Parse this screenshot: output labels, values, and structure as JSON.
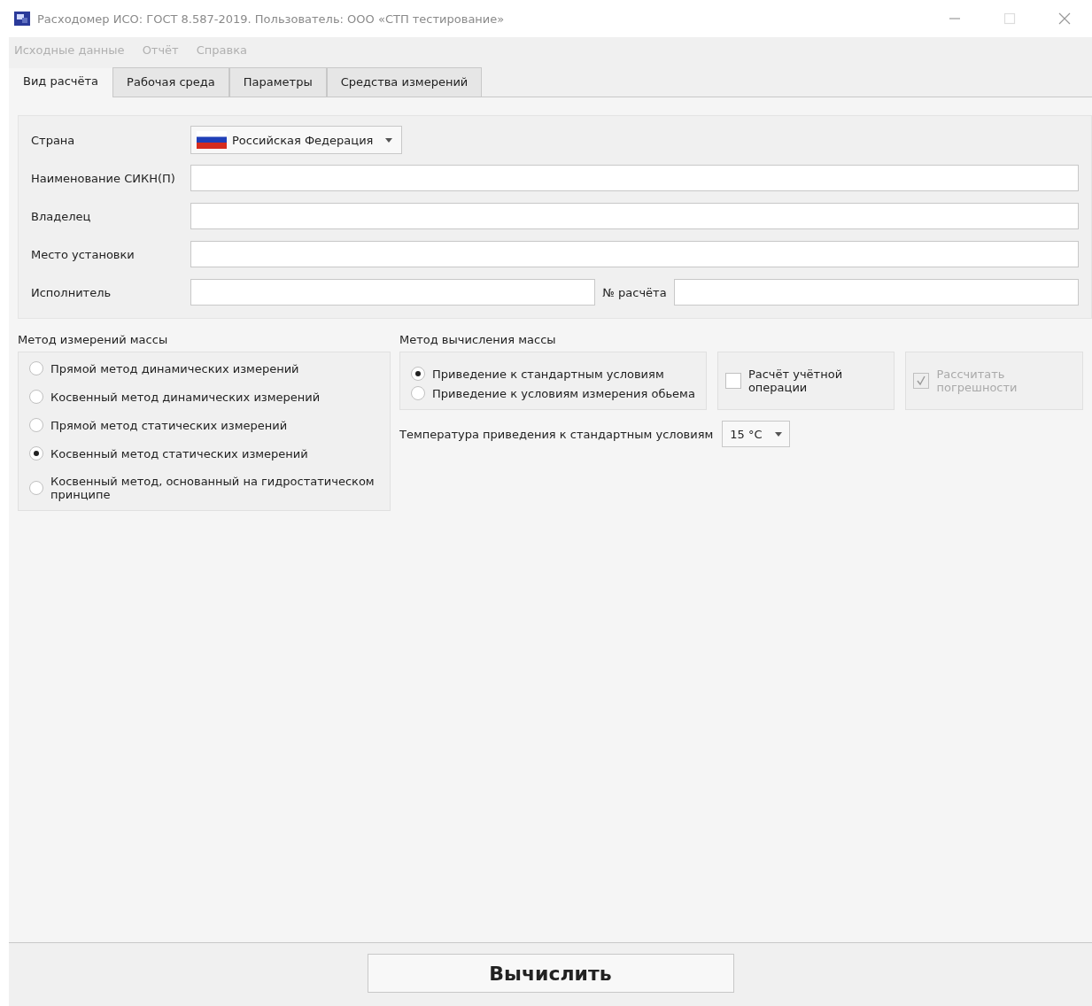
{
  "window": {
    "title": "Расходомер ИСО: ГОСТ 8.587-2019. Пользователь: ООО «СТП тестирование»"
  },
  "menu": [
    {
      "label": "Исходные данные"
    },
    {
      "label": "Отчёт"
    },
    {
      "label": "Справка"
    }
  ],
  "tabs": [
    {
      "label": "Вид расчёта",
      "selected": true
    },
    {
      "label": "Рабочая среда",
      "selected": false
    },
    {
      "label": "Параметры",
      "selected": false
    },
    {
      "label": "Средства измерений",
      "selected": false
    }
  ],
  "form": {
    "rows": [
      {
        "kind": "select",
        "label": "Страна",
        "value": "Российская Федерация"
      },
      {
        "kind": "text",
        "label": "Наименование СИКН(П)"
      },
      {
        "kind": "text",
        "label": "Владелец"
      },
      {
        "kind": "text",
        "label": "Место установки"
      },
      {
        "kind": "pair",
        "label": "Исполнитель",
        "second_label": "№ расчёта"
      }
    ]
  },
  "mass_method": {
    "title": "Метод измерений массы",
    "options": [
      {
        "label": "Прямой метод динамических измерений",
        "selected": false
      },
      {
        "label": "Косвенный метод динамических измерений",
        "selected": false
      },
      {
        "label": "Прямой метод статических измерений",
        "selected": false
      },
      {
        "label": "Косвенный метод статических измерений",
        "selected": true
      },
      {
        "label": "Косвенный метод, основанный на гидростатическом принципе",
        "selected": false
      }
    ]
  },
  "calc_method": {
    "title": "Метод вычисления массы",
    "options": [
      {
        "label": "Приведение к стандартным условиям",
        "selected": true
      },
      {
        "label": "Приведение к условиям измерения обьема",
        "selected": false
      }
    ]
  },
  "checkboxes": [
    {
      "label": "Расчёт учётной операции",
      "checked": false,
      "disabled": false
    },
    {
      "label": "Рассчитать погрешности",
      "checked": true,
      "disabled": true
    }
  ],
  "temperature": {
    "label": "Температура приведения к стандартным условиям",
    "value": "15 °C"
  },
  "compute_button": {
    "label": "Вычислить"
  }
}
